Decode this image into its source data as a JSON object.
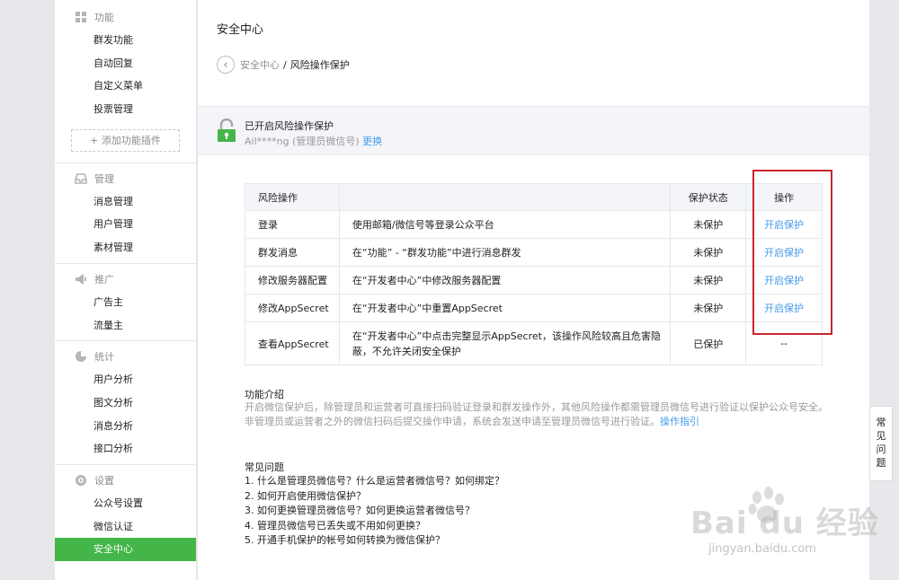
{
  "sidebar": {
    "sections": [
      {
        "title": "功能",
        "icon": "grid-icon",
        "items": [
          "群发功能",
          "自动回复",
          "自定义菜单",
          "投票管理"
        ],
        "add_plugin": "添加功能插件"
      },
      {
        "title": "管理",
        "icon": "inbox-icon",
        "items": [
          "消息管理",
          "用户管理",
          "素材管理"
        ]
      },
      {
        "title": "推广",
        "icon": "megaphone-icon",
        "items": [
          "广告主",
          "流量主"
        ]
      },
      {
        "title": "统计",
        "icon": "pie-chart-icon",
        "items": [
          "用户分析",
          "图文分析",
          "消息分析",
          "接口分析"
        ]
      },
      {
        "title": "设置",
        "icon": "gear-icon",
        "items": [
          "公众号设置",
          "微信认证",
          "安全中心"
        ]
      }
    ],
    "active_item": "安全中心"
  },
  "header": {
    "title": "安全中心",
    "breadcrumb": {
      "parent": "安全中心",
      "separator": "/",
      "current": "风险操作保护"
    }
  },
  "status": {
    "title": "已开启风险操作保护",
    "account": "Ail****ng (管理员微信号)",
    "change_link": "更换"
  },
  "table": {
    "headers": [
      "风险操作",
      "",
      "保护状态",
      "操作"
    ],
    "rows": [
      {
        "op": "登录",
        "desc": "使用邮箱/微信号等登录公众平台",
        "status": "未保护",
        "action": "开启保护"
      },
      {
        "op": "群发消息",
        "desc": "在“功能” - “群发功能”中进行消息群发",
        "status": "未保护",
        "action": "开启保护"
      },
      {
        "op": "修改服务器配置",
        "desc": "在“开发者中心”中修改服务器配置",
        "status": "未保护",
        "action": "开启保护"
      },
      {
        "op": "修改AppSecret",
        "desc": "在“开发者中心”中重置AppSecret",
        "status": "未保护",
        "action": "开启保护"
      },
      {
        "op": "查看AppSecret",
        "desc": "在“开发者中心”中点击完整显示AppSecret，该操作风险较高且危害隐蔽，不允许关闭安全保护",
        "status": "已保护",
        "action": "--"
      }
    ]
  },
  "intro": {
    "title": "功能介绍",
    "line1": "开启微信保护后，除管理员和运营者可直接扫码验证登录和群发操作外，其他风险操作都需管理员微信号进行验证以保护公众号安全。",
    "line2": "非管理员或运营者之外的微信扫码后提交操作申请，系统会发送申请至管理员微信号进行验证。",
    "link": "操作指引"
  },
  "faq": {
    "title": "常见问题",
    "items": [
      "1. 什么是管理员微信号？什么是运营者微信号？如何绑定？",
      "2. 如何开启使用微信保护？",
      "3. 如何更换管理员微信号？如何更换运营者微信号？",
      "4. 管理员微信号已丢失或不用如何更换？",
      "5. 开通手机保护的帐号如何转换为微信保护？"
    ],
    "side_tab": "常见问题"
  },
  "watermark": {
    "text": "Bai du 经验",
    "sub": "jingyan.baidu.com"
  },
  "colors": {
    "accent_green": "#44b549",
    "link_blue": "#459ae9",
    "highlight_red": "#c9252d"
  }
}
